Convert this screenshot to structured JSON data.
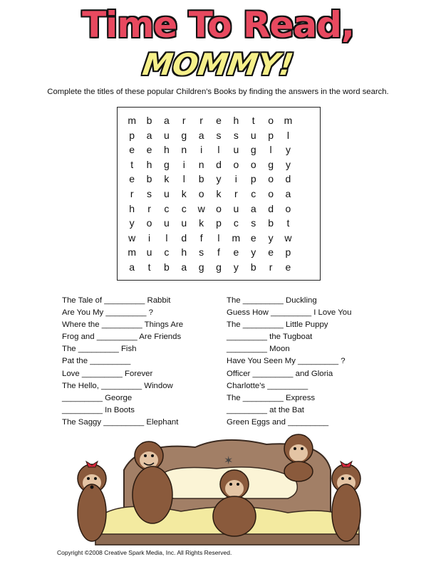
{
  "header": {
    "title": "Time To Read,",
    "subtitle": "MOMMY!",
    "instructions": "Complete the titles of these popular Children's Books by finding the answers in the word search."
  },
  "word_search": {
    "rows": [
      [
        "m",
        "b",
        "a",
        "r",
        "r",
        "e",
        "h",
        "t",
        "o",
        "m"
      ],
      [
        "p",
        "a",
        "u",
        "g",
        "a",
        "s",
        "s",
        "u",
        "p",
        "l"
      ],
      [
        "e",
        "e",
        "h",
        "n",
        "i",
        "l",
        "u",
        "g",
        "l",
        "y"
      ],
      [
        "t",
        "h",
        "g",
        "i",
        "n",
        "d",
        "o",
        "o",
        "g",
        "y"
      ],
      [
        "e",
        "b",
        "k",
        "l",
        "b",
        "y",
        "i",
        "p",
        "o",
        "d"
      ],
      [
        "r",
        "s",
        "u",
        "k",
        "o",
        "k",
        "r",
        "c",
        "o",
        "a"
      ],
      [
        "h",
        "r",
        "c",
        "c",
        "w",
        "o",
        "u",
        "a",
        "d",
        "o"
      ],
      [
        "y",
        "o",
        "u",
        "u",
        "k",
        "p",
        "c",
        "s",
        "b",
        "t"
      ],
      [
        "w",
        "i",
        "l",
        "d",
        "f",
        "l",
        "m",
        "e",
        "y",
        "w"
      ],
      [
        "m",
        "u",
        "c",
        "h",
        "s",
        "f",
        "e",
        "y",
        "e",
        "p"
      ],
      [
        "a",
        "t",
        "b",
        "a",
        "g",
        "g",
        "y",
        "b",
        "r",
        "e"
      ]
    ]
  },
  "clues": {
    "left": [
      "The Tale of _________ Rabbit",
      "Are You My _________ ?",
      "Where the _________ Things Are",
      "Frog and _________ Are Friends",
      "The _________ Fish",
      "Pat the _________",
      "Love _________ Forever",
      "The Hello, _________ Window",
      "_________ George",
      "_________ In Boots",
      "The Saggy _________ Elephant"
    ],
    "right": [
      "The _________ Duckling",
      "Guess How _________ I Love You",
      "The _________ Little Puppy",
      "_________ the Tugboat",
      "_________ Moon",
      "Have You Seen My _________ ?",
      "Officer _________ and Gloria",
      "Charlotte's _________",
      "The _________ Express",
      "_________ at the Bat",
      "Green Eggs and _________"
    ]
  },
  "footer": {
    "copyright": "Copyright ©2008   Creative Spark Media, Inc.  All Rights Reserved."
  },
  "colors": {
    "title_red": "#e8495f",
    "title_yellow": "#f6f08a",
    "monkey_brown": "#8a5a3c",
    "bed_tan": "#a27f66",
    "blanket": "#f3eaa0"
  }
}
